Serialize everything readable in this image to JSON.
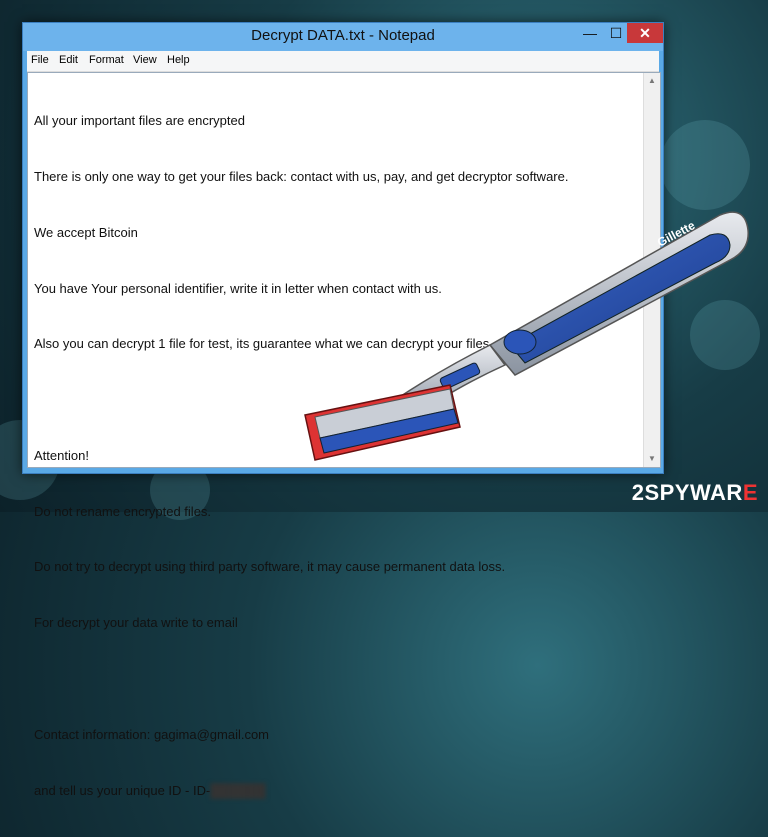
{
  "window": {
    "title": "Decrypt DATA.txt - Notepad",
    "controls": {
      "minimize": "—",
      "maximize": "☐",
      "close": "✕"
    }
  },
  "menu": [
    "File",
    "Edit",
    "Format",
    "View",
    "Help"
  ],
  "document": {
    "lines": [
      "All your important files are encrypted",
      "There is only one way to get your files back: contact with us, pay, and get decryptor software.",
      "We accept Bitcoin",
      "You have Your personal identifier, write it in letter when contact with us.",
      "Also you can decrypt 1 file for test, its guarantee what we can decrypt your files.",
      "",
      "Attention!",
      "Do not rename encrypted files.",
      "Do not try to decrypt using third party software, it may cause permanent data loss.",
      "For decrypt your data write to email",
      "",
      "Contact information: gagima@gmail.com"
    ],
    "id_prefix": "and tell us your unique ID - ID-",
    "id_value": "██████"
  },
  "razor": {
    "brand_label": "Gillette"
  },
  "watermark": {
    "prefix": "2SPYWAR",
    "suffix": "E"
  }
}
